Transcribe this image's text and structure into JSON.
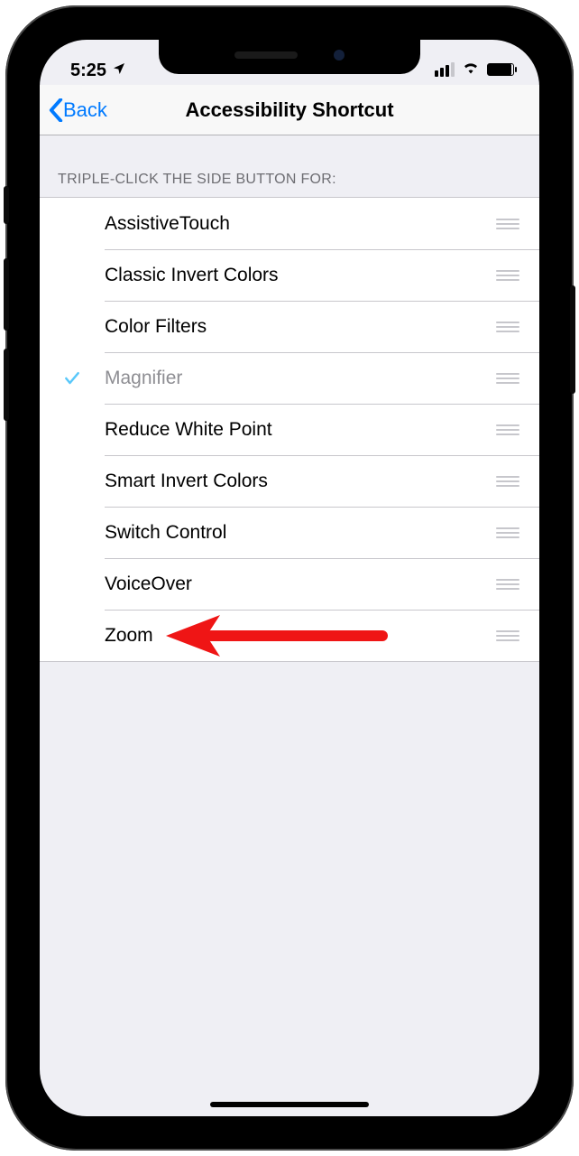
{
  "statusbar": {
    "time": "5:25"
  },
  "nav": {
    "back_label": "Back",
    "title": "Accessibility Shortcut"
  },
  "section_header": "TRIPLE-CLICK THE SIDE BUTTON FOR:",
  "rows": [
    {
      "label": "AssistiveTouch",
      "selected": false
    },
    {
      "label": "Classic Invert Colors",
      "selected": false
    },
    {
      "label": "Color Filters",
      "selected": false
    },
    {
      "label": "Magnifier",
      "selected": true
    },
    {
      "label": "Reduce White Point",
      "selected": false
    },
    {
      "label": "Smart Invert Colors",
      "selected": false
    },
    {
      "label": "Switch Control",
      "selected": false
    },
    {
      "label": "VoiceOver",
      "selected": false
    },
    {
      "label": "Zoom",
      "selected": false
    }
  ],
  "annotation": {
    "points_to_row": 8
  },
  "colors": {
    "link": "#007aff",
    "check": "#5ac8fa",
    "arrow": "#ef1515"
  }
}
